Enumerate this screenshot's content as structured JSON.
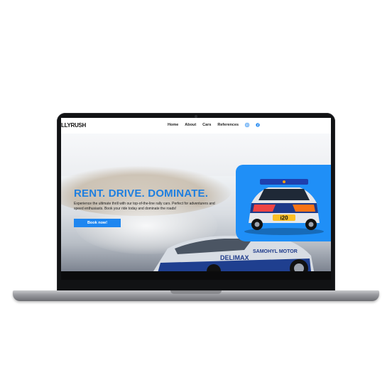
{
  "site": {
    "logo": "LLYRUSH",
    "nav": [
      "Home",
      "About",
      "Cars",
      "References"
    ],
    "nav_icons": [
      "instagram-icon",
      "facebook-icon"
    ]
  },
  "hero": {
    "headline": "RENT. DRIVE. DOMINATE.",
    "description": "Experience the ultimate thrill with our top-of-the-line rally cars. Perfect for adventurers and speed enthusiasts. Book your ride today and dominate the roads!",
    "cta_label": "Book now!",
    "bg_car_text_1": "DELIMAX",
    "bg_car_text_2": "SAMOHYL MOTOR",
    "card_plate": "i20"
  },
  "colors": {
    "accent": "#1e7fe0",
    "card": "#1f8ff7",
    "bezel": "#111214"
  }
}
